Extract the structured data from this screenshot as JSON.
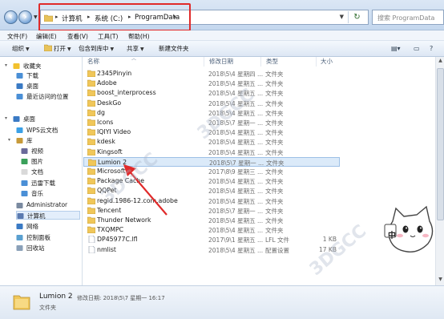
{
  "address_bar": {
    "crumbs": [
      "计算机",
      "系统 (C:)",
      "ProgramData"
    ],
    "search_placeholder": "搜索 ProgramData"
  },
  "menu": [
    "文件(F)",
    "编辑(E)",
    "查看(V)",
    "工具(T)",
    "帮助(H)"
  ],
  "toolbar": {
    "organize": "组织",
    "open": "打开",
    "include_in_library": "包含到库中",
    "share": "共享",
    "new_folder": "新建文件夹"
  },
  "sidebar": {
    "items": [
      {
        "label": "收藏夹",
        "icon": "star-icon"
      },
      {
        "label": "下载",
        "icon": "download-folder-icon"
      },
      {
        "label": "桌面",
        "icon": "desktop-icon"
      },
      {
        "label": "最近访问的位置",
        "icon": "recent-places-icon"
      },
      {
        "label": "桌面",
        "icon": "desktop-icon"
      },
      {
        "label": "WPS云文档",
        "icon": "cloud-icon"
      },
      {
        "label": "库",
        "icon": "library-icon"
      },
      {
        "label": "视频",
        "icon": "video-icon"
      },
      {
        "label": "图片",
        "icon": "picture-icon"
      },
      {
        "label": "文档",
        "icon": "document-icon"
      },
      {
        "label": "迅雷下载",
        "icon": "thunder-download-icon"
      },
      {
        "label": "音乐",
        "icon": "music-icon"
      },
      {
        "label": "Administrator",
        "icon": "user-icon"
      },
      {
        "label": "计算机",
        "icon": "computer-icon"
      },
      {
        "label": "网络",
        "icon": "network-icon"
      },
      {
        "label": "控制面板",
        "icon": "control-panel-icon"
      },
      {
        "label": "回收站",
        "icon": "recycle-bin-icon"
      }
    ]
  },
  "columns": {
    "name": "名称",
    "date": "修改日期",
    "type": "类型",
    "size": "大小"
  },
  "files": [
    {
      "name": "2345Pinyin",
      "date": "2018\\5\\4 星期四 ...",
      "type": "文件夹",
      "size": "",
      "kind": "folder"
    },
    {
      "name": "Adobe",
      "date": "2018\\5\\4 星期五 ...",
      "type": "文件夹",
      "size": "",
      "kind": "folder"
    },
    {
      "name": "boost_interprocess",
      "date": "2018\\5\\4 星期五 ...",
      "type": "文件夹",
      "size": "",
      "kind": "folder"
    },
    {
      "name": "DeskGo",
      "date": "2018\\5\\4 星期五 ...",
      "type": "文件夹",
      "size": "",
      "kind": "folder"
    },
    {
      "name": "dg",
      "date": "2018\\5\\4 星期五 ...",
      "type": "文件夹",
      "size": "",
      "kind": "folder"
    },
    {
      "name": "Icons",
      "date": "2018\\5\\7 星期一 ...",
      "type": "文件夹",
      "size": "",
      "kind": "folder"
    },
    {
      "name": "IQIYI Video",
      "date": "2018\\5\\4 星期五 ...",
      "type": "文件夹",
      "size": "",
      "kind": "folder"
    },
    {
      "name": "kdesk",
      "date": "2018\\5\\4 星期五 ...",
      "type": "文件夹",
      "size": "",
      "kind": "folder"
    },
    {
      "name": "Kingsoft",
      "date": "2018\\5\\4 星期五 ...",
      "type": "文件夹",
      "size": "",
      "kind": "folder"
    },
    {
      "name": "Lumion 2",
      "date": "2018\\5\\7 星期一 ...",
      "type": "文件夹",
      "size": "",
      "kind": "folder",
      "selected": true
    },
    {
      "name": "Microsoft",
      "date": "2017\\8\\9 星期三 ...",
      "type": "文件夹",
      "size": "",
      "kind": "folder"
    },
    {
      "name": "Package Cache",
      "date": "2018\\5\\4 星期五 ...",
      "type": "文件夹",
      "size": "",
      "kind": "folder"
    },
    {
      "name": "QQPet",
      "date": "2018\\5\\4 星期五 ...",
      "type": "文件夹",
      "size": "",
      "kind": "folder"
    },
    {
      "name": "regid.1986-12.com.adobe",
      "date": "2018\\5\\4 星期五 ...",
      "type": "文件夹",
      "size": "",
      "kind": "folder"
    },
    {
      "name": "Tencent",
      "date": "2018\\5\\7 星期一 ...",
      "type": "文件夹",
      "size": "",
      "kind": "folder"
    },
    {
      "name": "Thunder Network",
      "date": "2018\\5\\4 星期五 ...",
      "type": "文件夹",
      "size": "",
      "kind": "folder"
    },
    {
      "name": "TXQMPC",
      "date": "2018\\5\\4 星期五 ...",
      "type": "文件夹",
      "size": "",
      "kind": "folder"
    },
    {
      "name": "DP45977C.lfl",
      "date": "2017\\9\\1 星期五 ...",
      "type": "LFL 文件",
      "size": "1 KB",
      "kind": "file"
    },
    {
      "name": "nmlist",
      "date": "2018\\5\\4 星期五 ...",
      "type": "配置设置",
      "size": "17 KB",
      "kind": "file"
    }
  ],
  "details": {
    "name": "Lumion 2",
    "meta": "修改日期: 2018\\5\\7 星期一 16:17",
    "type": "文件夹"
  },
  "mascot_char": "中",
  "colors": {
    "highlight": "#e02a2a",
    "selection": "#dbeaf9",
    "folder": "#f0c75a"
  }
}
